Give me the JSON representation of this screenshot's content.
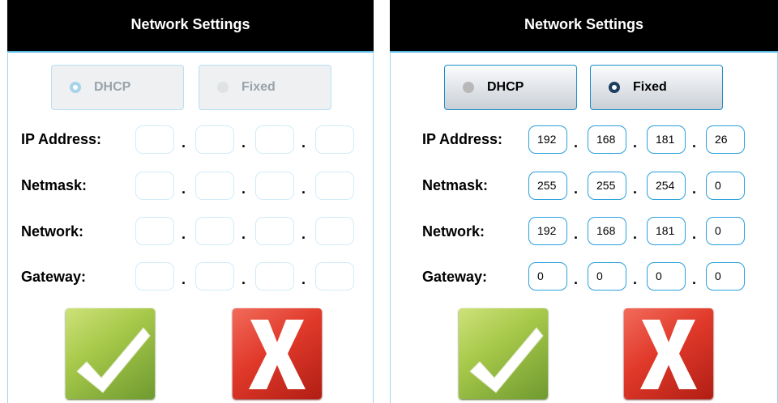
{
  "panels": [
    {
      "title": "Network Settings",
      "mode": "DHCP",
      "enabled": false,
      "toggle": {
        "dhcp_label": "DHCP",
        "fixed_label": "Fixed"
      },
      "labels": {
        "ip": "IP Address:",
        "netmask": "Netmask:",
        "network": "Network:",
        "gateway": "Gateway:"
      },
      "separator": ".",
      "values": {
        "ip": [
          "",
          "",
          "",
          ""
        ],
        "netmask": [
          "",
          "",
          "",
          ""
        ],
        "network": [
          "",
          "",
          "",
          ""
        ],
        "gateway": [
          "",
          "",
          "",
          ""
        ]
      }
    },
    {
      "title": "Network Settings",
      "mode": "Fixed",
      "enabled": true,
      "toggle": {
        "dhcp_label": "DHCP",
        "fixed_label": "Fixed"
      },
      "labels": {
        "ip": "IP Address:",
        "netmask": "Netmask:",
        "network": "Network:",
        "gateway": "Gateway:"
      },
      "separator": ".",
      "values": {
        "ip": [
          "192",
          "168",
          "181",
          "26"
        ],
        "netmask": [
          "255",
          "255",
          "254",
          "0"
        ],
        "network": [
          "192",
          "168",
          "181",
          "0"
        ],
        "gateway": [
          "0",
          "0",
          "0",
          "0"
        ]
      }
    }
  ],
  "icons": {
    "confirm": "checkmark-icon",
    "cancel": "x-icon"
  },
  "colors": {
    "accent": "#2aa0dc",
    "header_bg": "#000000",
    "confirm_green": "#8fb63c",
    "cancel_red": "#e0392a"
  }
}
